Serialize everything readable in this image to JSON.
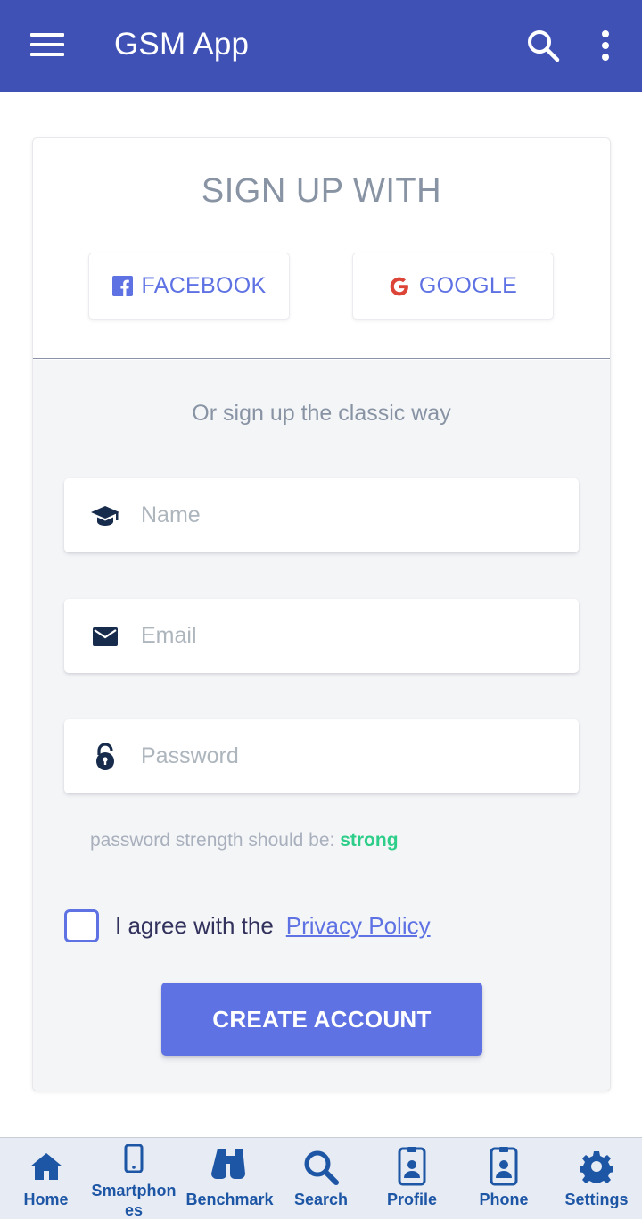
{
  "appbar": {
    "title": "GSM App",
    "menu_icon": "menu-icon",
    "search_icon": "search-icon",
    "more_icon": "more-vertical-icon",
    "color": "#3f51b5"
  },
  "signup": {
    "heading": "SIGN UP WITH",
    "facebook_label": "FACEBOOK",
    "google_label": "GOOGLE",
    "classic_text": "Or sign up the classic way",
    "name_placeholder": "Name",
    "email_placeholder": "Email",
    "password_placeholder": "Password",
    "strength_prefix": "password strength should be:",
    "strength_value": "strong",
    "agree_text": "I agree with the",
    "privacy_link": "Privacy Policy",
    "create_button": "CREATE ACCOUNT",
    "accent_color": "#5e72e4",
    "strength_color": "#2dce89"
  },
  "bottom_nav": {
    "items": [
      {
        "label": "Home",
        "icon": "home-icon"
      },
      {
        "label": "Smartphon es",
        "icon": "smartphone-icon"
      },
      {
        "label": "Benchmark",
        "icon": "binoculars-icon"
      },
      {
        "label": "Search",
        "icon": "search-icon"
      },
      {
        "label": "Profile",
        "icon": "id-badge-icon"
      },
      {
        "label": "Phone",
        "icon": "id-badge-icon"
      },
      {
        "label": "Settings",
        "icon": "gear-icon"
      }
    ]
  }
}
